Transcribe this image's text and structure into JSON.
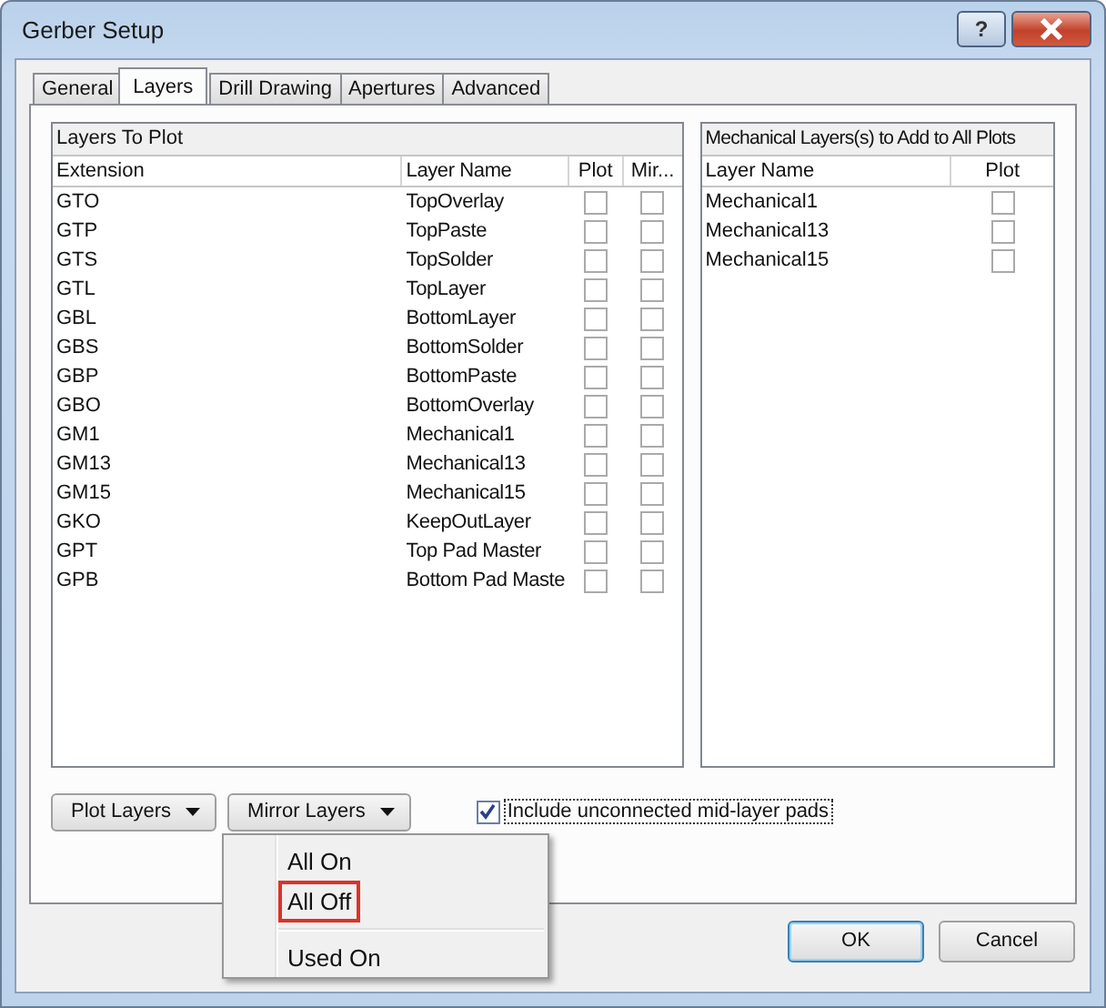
{
  "window": {
    "title": "Gerber Setup",
    "help_button": "?"
  },
  "tabs": [
    {
      "label": "General",
      "selected": false
    },
    {
      "label": "Layers",
      "selected": true
    },
    {
      "label": "Drill Drawing",
      "selected": false
    },
    {
      "label": "Apertures",
      "selected": false
    },
    {
      "label": "Advanced",
      "selected": false
    }
  ],
  "layers_to_plot": {
    "title": "Layers To Plot",
    "columns": [
      "Extension",
      "Layer Name",
      "Plot",
      "Mir..."
    ],
    "rows": [
      {
        "extension": "GTO",
        "layer": "TopOverlay",
        "plot": false,
        "mirror": false
      },
      {
        "extension": "GTP",
        "layer": "TopPaste",
        "plot": false,
        "mirror": false
      },
      {
        "extension": "GTS",
        "layer": "TopSolder",
        "plot": false,
        "mirror": false
      },
      {
        "extension": "GTL",
        "layer": "TopLayer",
        "plot": false,
        "mirror": false
      },
      {
        "extension": "GBL",
        "layer": "BottomLayer",
        "plot": false,
        "mirror": false
      },
      {
        "extension": "GBS",
        "layer": "BottomSolder",
        "plot": false,
        "mirror": false
      },
      {
        "extension": "GBP",
        "layer": "BottomPaste",
        "plot": false,
        "mirror": false
      },
      {
        "extension": "GBO",
        "layer": "BottomOverlay",
        "plot": false,
        "mirror": false
      },
      {
        "extension": "GM1",
        "layer": "Mechanical1",
        "plot": false,
        "mirror": false
      },
      {
        "extension": "GM13",
        "layer": "Mechanical13",
        "plot": false,
        "mirror": false
      },
      {
        "extension": "GM15",
        "layer": "Mechanical15",
        "plot": false,
        "mirror": false
      },
      {
        "extension": "GKO",
        "layer": "KeepOutLayer",
        "plot": false,
        "mirror": false
      },
      {
        "extension": "GPT",
        "layer": "Top Pad Master",
        "plot": false,
        "mirror": false
      },
      {
        "extension": "GPB",
        "layer": "Bottom Pad Maste",
        "plot": false,
        "mirror": false
      }
    ]
  },
  "mechanical_layers": {
    "title": "Mechanical Layers(s) to Add to All Plots",
    "columns": [
      "Layer Name",
      "Plot"
    ],
    "rows": [
      {
        "layer": "Mechanical1",
        "plot": false
      },
      {
        "layer": "Mechanical13",
        "plot": false
      },
      {
        "layer": "Mechanical15",
        "plot": false
      }
    ]
  },
  "buttons": [
    {
      "label": "Plot Layers"
    },
    {
      "label": "Mirror Layers"
    }
  ],
  "include_pads": {
    "label": "Include unconnected mid-layer pads",
    "checked": true
  },
  "menu": [
    {
      "label": "All On",
      "highlighted": false,
      "separator_before": false
    },
    {
      "label": "All Off",
      "highlighted": true,
      "separator_before": false
    },
    {
      "label": "Used On",
      "highlighted": false,
      "separator_before": true
    }
  ],
  "footer_buttons": [
    {
      "label": "OK",
      "default": true
    },
    {
      "label": "Cancel",
      "default": false
    }
  ]
}
